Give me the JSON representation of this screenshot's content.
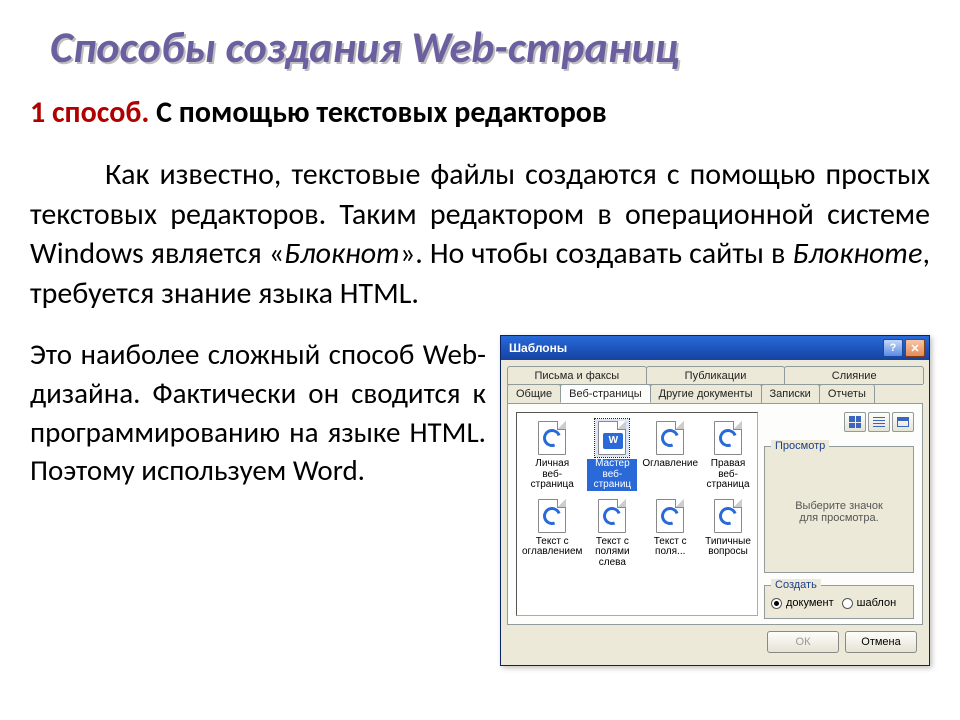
{
  "title": "Способы создания Web-страниц",
  "subhead": {
    "lead": "1 способ. ",
    "rest": "С помощью текстовых редакторов"
  },
  "para1": {
    "a": "Как известно, текстовые файлы создаются с помощью простых текстовых редакторов. Таким редактором в операционной системе Windows является «",
    "b": "Блокнот",
    "c": "». Но чтобы создавать сайты в ",
    "d": "Блокноте",
    "e": ", требуется знание языка HTML."
  },
  "para2": "Это наиболее сложный способ Web-дизайна. Фактически он сводится к программированию на языке HTML. Поэтому используем Word.",
  "dialog": {
    "title": "Шаблоны",
    "tabs_top": [
      "Письма и факсы",
      "Публикации",
      "Слияние"
    ],
    "tabs_bottom": [
      "Общие",
      "Веб-страницы",
      "Другие документы",
      "Записки",
      "Отчеты"
    ],
    "active_tab_index": 1,
    "preview_legend": "Просмотр",
    "preview_text": "Выберите значок\nдля просмотра.",
    "create_legend": "Создать",
    "create_opts": [
      "документ",
      "шаблон"
    ],
    "create_selected": 0,
    "ok": "ОК",
    "cancel": "Отмена",
    "help_char": "?",
    "close_char": "✕",
    "word_badge": "W",
    "templates": [
      {
        "label": "Личная\nвеб-страница",
        "kind": "ie",
        "sel": false
      },
      {
        "label": "Мастер\nвеб-страниц",
        "kind": "word",
        "sel": true
      },
      {
        "label": "Оглавление",
        "kind": "ie",
        "sel": false
      },
      {
        "label": "Правая\nвеб-страница",
        "kind": "ie",
        "sel": false
      },
      {
        "label": "Текст с\nоглавлением",
        "kind": "ie",
        "sel": false
      },
      {
        "label": "Текст с\nполями слева",
        "kind": "ie",
        "sel": false
      },
      {
        "label": "Текст с\nполя...",
        "kind": "ie",
        "sel": false
      },
      {
        "label": "Типичные\nвопросы",
        "kind": "ie",
        "sel": false
      }
    ]
  }
}
